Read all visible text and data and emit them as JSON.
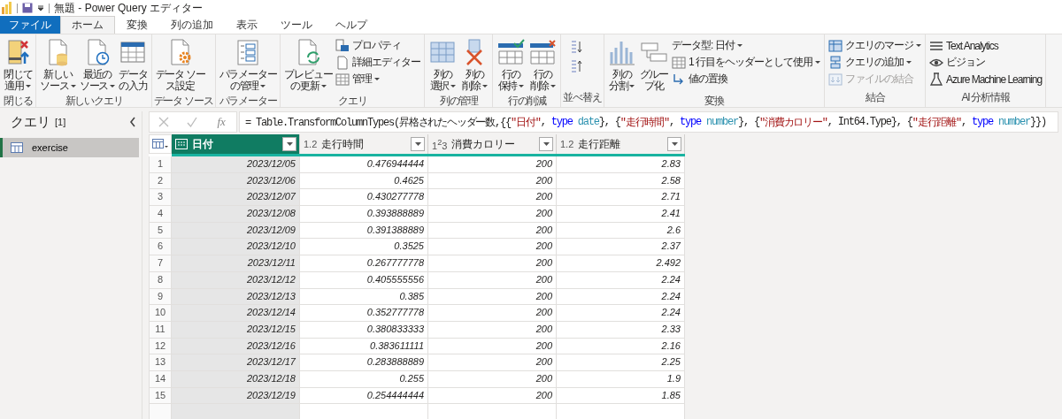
{
  "window": {
    "title": "無題 - Power Query エディター"
  },
  "tabs": [
    {
      "label": "ファイル",
      "kind": "file",
      "selected": false
    },
    {
      "label": "ホーム",
      "kind": "tab",
      "selected": true
    },
    {
      "label": "変換",
      "kind": "tab",
      "selected": false
    },
    {
      "label": "列の追加",
      "kind": "tab",
      "selected": false
    },
    {
      "label": "表示",
      "kind": "tab",
      "selected": false
    },
    {
      "label": "ツール",
      "kind": "tab",
      "selected": false
    },
    {
      "label": "ヘルプ",
      "kind": "tab",
      "selected": false
    }
  ],
  "ribbon": [
    {
      "label": "閉じる",
      "kind": "buttons",
      "large": [
        {
          "lines": [
            "閉じて",
            "適用"
          ],
          "dropdown": true
        }
      ]
    },
    {
      "label": "新しいクエリ",
      "kind": "buttons",
      "large": [
        {
          "lines": [
            "新しい",
            "ソース"
          ],
          "dropdown": true
        },
        {
          "lines": [
            "最近の",
            "ソース"
          ],
          "dropdown": true
        },
        {
          "lines": [
            "データ",
            "の入力"
          ],
          "dropdown": false
        }
      ]
    },
    {
      "label": "データ ソース",
      "kind": "buttons",
      "large": [
        {
          "lines": [
            "データ ソー",
            "ス設定"
          ],
          "dropdown": false
        }
      ]
    },
    {
      "label": "パラメーター",
      "kind": "buttons",
      "large": [
        {
          "lines": [
            "パラメーター",
            "の管理"
          ],
          "dropdown": true
        }
      ]
    },
    {
      "label": "クエリ",
      "kind": "buttons",
      "large": [
        {
          "lines": [
            "プレビュー",
            "の更新"
          ],
          "dropdown": true
        }
      ],
      "small": [
        {
          "label": "プロパティ",
          "dropdown": false,
          "disabled": false
        },
        {
          "label": "詳細エディター",
          "dropdown": false,
          "disabled": false
        },
        {
          "label": "管理",
          "dropdown": true,
          "disabled": false
        }
      ]
    },
    {
      "label": "列の管理",
      "kind": "buttons",
      "large": [
        {
          "lines": [
            "列の",
            "選択"
          ],
          "dropdown": true
        },
        {
          "lines": [
            "列の",
            "削除"
          ],
          "dropdown": true
        }
      ]
    },
    {
      "label": "行の削減",
      "kind": "buttons",
      "large": [
        {
          "lines": [
            "行の",
            "保持"
          ],
          "dropdown": true
        },
        {
          "lines": [
            "行の",
            "削除"
          ],
          "dropdown": true
        }
      ]
    },
    {
      "label": "並べ替え",
      "kind": "sort"
    },
    {
      "label": "変換",
      "kind": "buttons",
      "large": [
        {
          "lines": [
            "列の",
            "分割"
          ],
          "dropdown": true
        },
        {
          "lines": [
            "グルー",
            "プ化"
          ],
          "dropdown": false
        }
      ],
      "small": [
        {
          "label": "データ型: 日付",
          "dropdown": true,
          "disabled": false
        },
        {
          "label": "1 行目をヘッダーとして使用",
          "dropdown": true,
          "disabled": false
        },
        {
          "label": "値の置換",
          "dropdown": false,
          "disabled": false
        }
      ]
    },
    {
      "label": "結合",
      "kind": "buttons",
      "small": [
        {
          "label": "クエリのマージ",
          "dropdown": true,
          "disabled": false
        },
        {
          "label": "クエリの追加",
          "dropdown": true,
          "disabled": false
        },
        {
          "label": "ファイルの結合",
          "dropdown": false,
          "disabled": true
        }
      ]
    },
    {
      "label": "AI 分析情報",
      "kind": "buttons",
      "small": [
        {
          "label": "Text Analytics",
          "dropdown": false,
          "disabled": false
        },
        {
          "label": "ビジョン",
          "dropdown": false,
          "disabled": false
        },
        {
          "label": "Azure Machine Learning",
          "dropdown": false,
          "disabled": false
        }
      ]
    }
  ],
  "queries_pane": {
    "title": "クエリ",
    "count": "[1]",
    "items": [
      {
        "label": "exercise",
        "selected": true
      }
    ]
  },
  "formula_bar": {
    "fx": "fx",
    "tokens": [
      {
        "kind": "plain",
        "text": "= Table.TransformColumnTypes(昇格されたヘッダー数,{{"
      },
      {
        "kind": "string",
        "text": "\"日付\""
      },
      {
        "kind": "plain",
        "text": ", "
      },
      {
        "kind": "keyword",
        "text": "type"
      },
      {
        "kind": "typename",
        "text": " date"
      },
      {
        "kind": "plain",
        "text": "}, {"
      },
      {
        "kind": "string",
        "text": "\"走行時間\""
      },
      {
        "kind": "plain",
        "text": ", "
      },
      {
        "kind": "keyword",
        "text": "type"
      },
      {
        "kind": "typename",
        "text": " number"
      },
      {
        "kind": "plain",
        "text": "}, {"
      },
      {
        "kind": "string",
        "text": "\"消費カロリー\""
      },
      {
        "kind": "plain",
        "text": ", Int64.Type}, {"
      },
      {
        "kind": "string",
        "text": "\"走行距離\""
      },
      {
        "kind": "plain",
        "text": ", "
      },
      {
        "kind": "keyword",
        "text": "type"
      },
      {
        "kind": "typename",
        "text": " number"
      },
      {
        "kind": "plain",
        "text": "}})"
      }
    ]
  },
  "table": {
    "columns": [
      {
        "kind": "date",
        "name": "日付",
        "selected": true
      },
      {
        "kind": "number",
        "type_label": "1.2",
        "name": "走行時間",
        "selected": false
      },
      {
        "kind": "number",
        "type_label": "1$^{2}$3",
        "name": "消費カロリー",
        "selected": false
      },
      {
        "kind": "number",
        "type_label": "1.2",
        "name": "走行距離",
        "selected": false
      }
    ],
    "rows": [
      [
        "1",
        "2023/12/05",
        "0.476944444",
        "200",
        "2.83"
      ],
      [
        "2",
        "2023/12/06",
        "0.4625",
        "200",
        "2.58"
      ],
      [
        "3",
        "2023/12/07",
        "0.430277778",
        "200",
        "2.71"
      ],
      [
        "4",
        "2023/12/08",
        "0.393888889",
        "200",
        "2.41"
      ],
      [
        "5",
        "2023/12/09",
        "0.391388889",
        "200",
        "2.6"
      ],
      [
        "6",
        "2023/12/10",
        "0.3525",
        "200",
        "2.37"
      ],
      [
        "7",
        "2023/12/11",
        "0.267777778",
        "200",
        "2.492"
      ],
      [
        "8",
        "2023/12/12",
        "0.405555556",
        "200",
        "2.24"
      ],
      [
        "9",
        "2023/12/13",
        "0.385",
        "200",
        "2.24"
      ],
      [
        "10",
        "2023/12/14",
        "0.352777778",
        "200",
        "2.24"
      ],
      [
        "11",
        "2023/12/15",
        "0.380833333",
        "200",
        "2.33"
      ],
      [
        "12",
        "2023/12/16",
        "0.383611111",
        "200",
        "2.16"
      ],
      [
        "13",
        "2023/12/17",
        "0.283888889",
        "200",
        "2.25"
      ],
      [
        "14",
        "2023/12/18",
        "0.255",
        "200",
        "1.9"
      ],
      [
        "15",
        "2023/12/19",
        "0.254444444",
        "200",
        "1.85"
      ]
    ]
  }
}
